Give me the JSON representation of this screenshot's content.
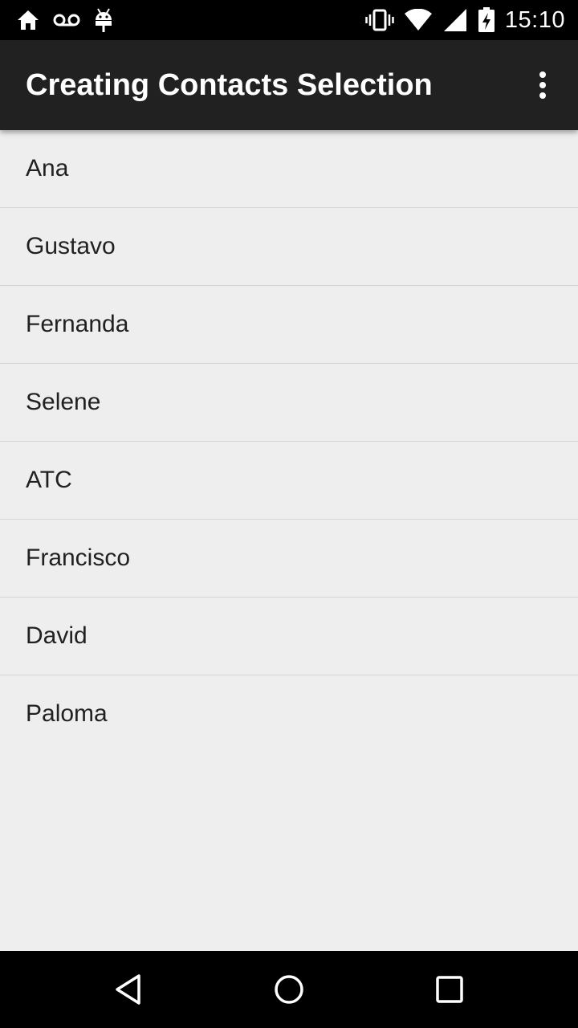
{
  "status_bar": {
    "time": "15:10",
    "icons_left": [
      "home-icon",
      "voicemail-icon",
      "android-debug-icon"
    ],
    "icons_right": [
      "vibrate-icon",
      "wifi-icon",
      "signal-icon",
      "battery-charging-icon"
    ]
  },
  "app_bar": {
    "title": "Creating Contacts Selection",
    "overflow_icon": "overflow-menu-icon"
  },
  "contacts": [
    {
      "name": "Ana"
    },
    {
      "name": "Gustavo"
    },
    {
      "name": "Fernanda"
    },
    {
      "name": "Selene"
    },
    {
      "name": "ATC"
    },
    {
      "name": "Francisco"
    },
    {
      "name": "David"
    },
    {
      "name": "Paloma"
    }
  ],
  "nav_bar": {
    "icons": [
      "back-icon",
      "home-circle-icon",
      "recents-icon"
    ]
  },
  "colors": {
    "status_bar_bg": "#000000",
    "app_bar_bg": "#212121",
    "list_bg": "#eeeeee",
    "divider": "#d4d4d4",
    "text_primary": "#212121"
  }
}
